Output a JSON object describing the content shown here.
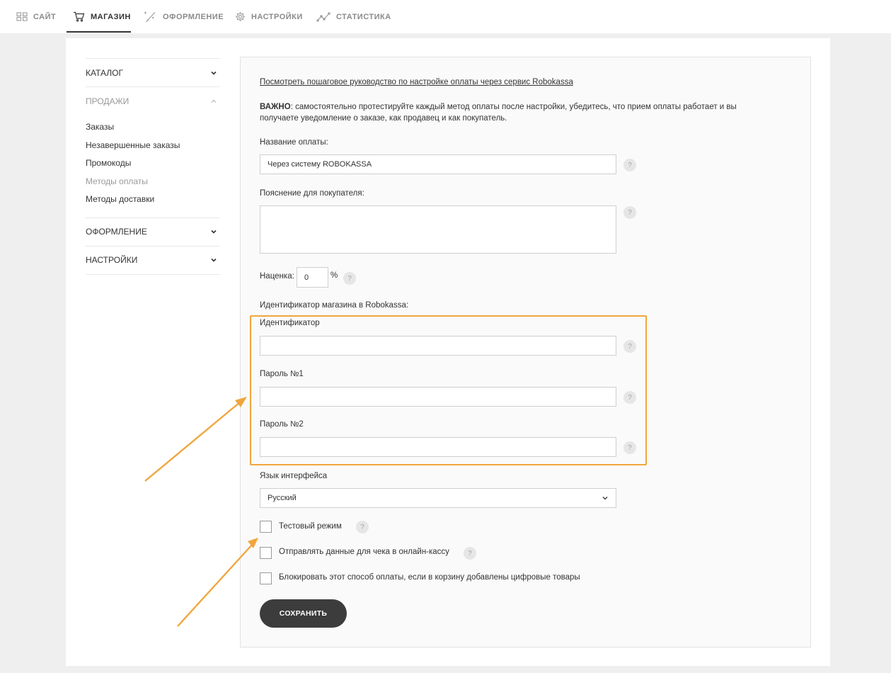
{
  "nav": {
    "site": "САЙТ",
    "shop": "МАГАЗИН",
    "design": "ОФОРМЛЕНИЕ",
    "settings": "НАСТРОЙКИ",
    "stats": "СТАТИСТИКА"
  },
  "sidebar": {
    "catalog": "КАТАЛОГ",
    "sales": "ПРОДАЖИ",
    "items": [
      "Заказы",
      "Незавершенные заказы",
      "Промокоды",
      "Методы оплаты",
      "Методы доставки"
    ],
    "design": "ОФОРМЛЕНИЕ",
    "settings": "НАСТРОЙКИ"
  },
  "form": {
    "guide_link": "Посмотреть пошаговое руководство по настройке оплаты через сервис Robokassa",
    "important_label": "ВАЖНО",
    "important_text_1": ": самостоятельно протестируйте каждый метод оплаты после настройки, убедитесь, что прием оплаты работает и вы",
    "important_text_2": "получаете уведомление о заказе, как продавец и как покупатель.",
    "payment_name_label": "Название оплаты:",
    "payment_name_value": "Через систему ROBOKASSA",
    "buyer_note_label": "Пояснение для покупателя:",
    "buyer_note_value": "",
    "markup_label": "Наценка:",
    "markup_value": "0",
    "markup_unit": "%",
    "shop_id_section": "Идентификатор магазина в Robokassa:",
    "identifier_label": "Идентификатор",
    "identifier_value": "",
    "password1_label": "Пароль №1",
    "password1_value": "",
    "password2_label": "Пароль №2",
    "password2_value": "",
    "language_label": "Язык интерфейса",
    "language_value": "Русский",
    "test_mode_label": "Тестовый режим",
    "receipt_label": "Отправлять данные для чека в онлайн-кассу",
    "block_digital_label": "Блокировать этот способ оплаты, если в корзину добавлены цифровые товары",
    "help_glyph": "?",
    "save_button": "СОХРАНИТЬ"
  },
  "colors": {
    "highlight": "#f0a63e",
    "button": "#3c3c3c"
  }
}
